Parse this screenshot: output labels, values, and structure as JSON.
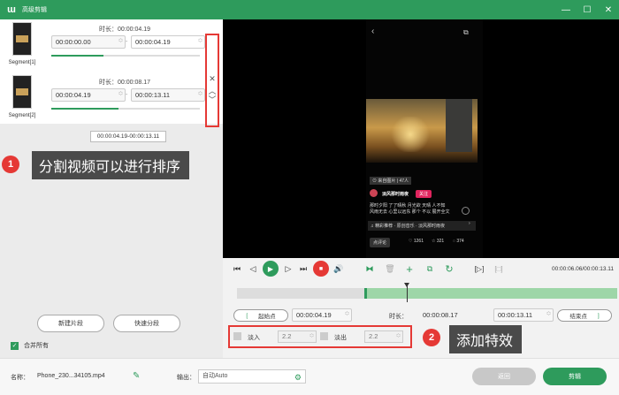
{
  "window": {
    "title": "高级剪辑",
    "logo_glyph": "ɯ",
    "btn_minimize": "—",
    "btn_maximize": "☐",
    "btn_close": "✕"
  },
  "segments": [
    {
      "name": "Segment[1]",
      "duration_label": "时长：00:00:04.19",
      "start": "00:00:00.00",
      "end": "00:00:04.19",
      "dash": "-",
      "progress": 0.35
    },
    {
      "name": "Segment[2]",
      "duration_label": "时长：00:00:08.17",
      "start": "00:00:04.19",
      "end": "00:00:13.11",
      "dash": "-",
      "progress": 0.45
    }
  ],
  "order_controls": {
    "delete": "✕",
    "up": "︿",
    "down": "﹀"
  },
  "tooltip": "00:00:04.19-00:00:13.11",
  "callouts": [
    {
      "number": "1",
      "text": "分割视频可以进行排序"
    },
    {
      "number": "2",
      "text": "添加特效"
    }
  ],
  "left_buttons": {
    "new_segment": "新建片段",
    "quick_split": "快速分段"
  },
  "merge_all": {
    "label": "合并所有",
    "checked": true,
    "mark": "✓"
  },
  "preview": {
    "back_icon": "‹",
    "share_icon": "⧉",
    "tag": "⊙ 来自图片 | 47人",
    "user": "淡风那时雨夜",
    "follow": "关注",
    "caption_line1": "那时夕阳 了了晴秋 月光欲 天晴 人不知",
    "caption_line2": "风雨无去 心里以远东 那个 不以 展开全文",
    "music": "♫ 精彩推荐 · 原创音乐 · 淡风那时雨夜",
    "music_arrow": "›",
    "comment_placeholder": "点评论",
    "stats": [
      "♡ 1261",
      "☆ 321",
      "◌ 374"
    ]
  },
  "transport": {
    "skip_start": "⏮",
    "prev": "◁",
    "play": "▶",
    "next": "▷",
    "mark": "⏭",
    "stop": "■",
    "volume": "🔊",
    "split": "⧓",
    "delete": "🗑",
    "add": "+",
    "copy": "⧉",
    "reset": "↻",
    "frame1": "[▷]",
    "frame2": "[□]",
    "time": "00:00:06.06/00:00:13.11"
  },
  "trim": {
    "start_btn": "起始点",
    "start_time": "00:00:04.19",
    "duration_label": "时长：",
    "duration": "00:00:08.17",
    "end_time": "00:00:13.11",
    "end_btn": "结束点",
    "spin": "︿﹀",
    "bracket_l": "[",
    "bracket_r": "]"
  },
  "fade": {
    "in_label": "淡入",
    "in_value": "2.2",
    "out_label": "淡出",
    "out_value": "2.2",
    "spin": "︿﹀"
  },
  "bottom": {
    "name_label": "名称：",
    "name_value": "Phone_230...34105.mp4",
    "edit_icon": "✎",
    "output_label": "输出：",
    "output_value": "自动Auto",
    "settings_icon": "⚙",
    "back": "返回",
    "cut": "剪辑"
  }
}
